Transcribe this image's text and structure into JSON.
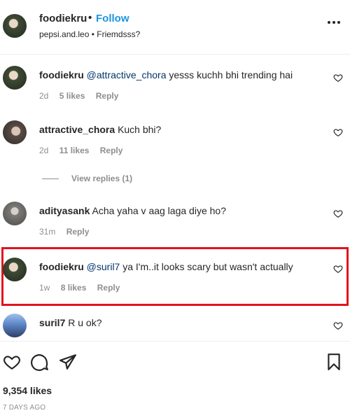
{
  "post_header": {
    "username": "foodiekru",
    "separator": "•",
    "follow_label": "Follow",
    "subtitle": "pepsi.and.leo • Friemdsss?",
    "more_icon": "more-horizontal-icon"
  },
  "comments": [
    {
      "username": "foodiekru",
      "mention": "@attractive_chora",
      "text": " yesss kuchh bhi trending hai",
      "time": "2d",
      "likes": "5 likes",
      "reply": "Reply"
    },
    {
      "username": "attractive_chora",
      "mention": "",
      "text": "Kuch bhi?",
      "time": "2d",
      "likes": "11 likes",
      "reply": "Reply",
      "view_replies": "View replies (1)"
    },
    {
      "username": "adityasank",
      "mention": "",
      "text": "Acha yaha v aag laga diye ho?",
      "time": "31m",
      "likes": "",
      "reply": "Reply"
    },
    {
      "username": "foodiekru",
      "mention": "@suril7",
      "text": " ya I'm..it looks scary but wasn't actually",
      "time": "1w",
      "likes": "8 likes",
      "reply": "Reply",
      "highlighted": true
    },
    {
      "username": "suril7",
      "mention": "",
      "text": "R u ok?",
      "time": "",
      "likes": "",
      "reply": ""
    }
  ],
  "actions": {
    "like_icon": "heart-icon",
    "comment_icon": "comment-icon",
    "share_icon": "share-icon",
    "save_icon": "bookmark-icon"
  },
  "stats": {
    "likes": "9,354 likes",
    "timestamp": "7 DAYS AGO"
  },
  "colors": {
    "link_blue": "#1b95e0",
    "mention_blue": "#00376b",
    "highlight_red": "#e0141e",
    "meta_gray": "#8e8e8e"
  }
}
